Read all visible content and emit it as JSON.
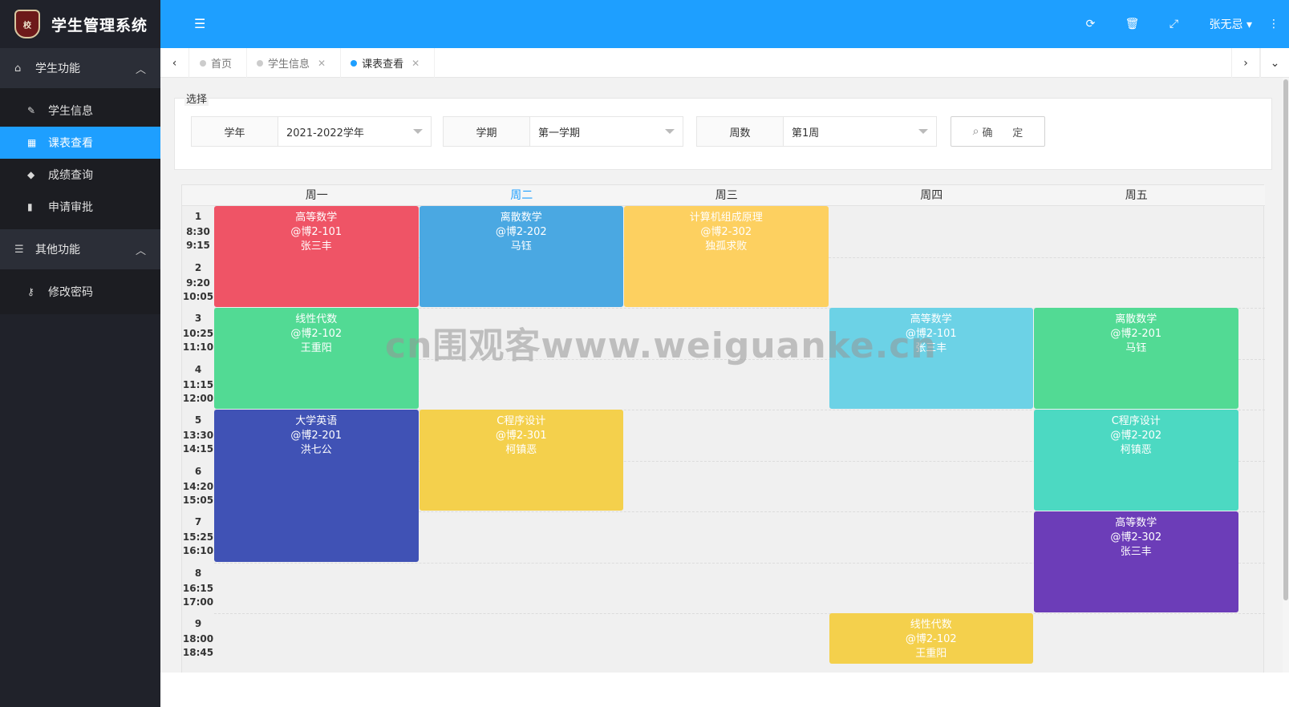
{
  "app": {
    "title": "学生管理系统",
    "logo_text": "校"
  },
  "sidebar": {
    "groups": [
      {
        "label": "学生功能",
        "icon": "home-icon",
        "items": [
          {
            "label": "学生信息",
            "icon": "pencil-icon"
          },
          {
            "label": "课表查看",
            "icon": "table-icon"
          },
          {
            "label": "成绩查询",
            "icon": "graduation-cap-icon"
          },
          {
            "label": "申请审批",
            "icon": "book-icon"
          }
        ]
      },
      {
        "label": "其他功能",
        "icon": "list-icon",
        "items": [
          {
            "label": "修改密码",
            "icon": "key-icon"
          }
        ]
      }
    ]
  },
  "header": {
    "user": "张无忌"
  },
  "tabs": [
    {
      "label": "首页"
    },
    {
      "label": "学生信息"
    },
    {
      "label": "课表查看"
    }
  ],
  "filter": {
    "legend": "选择",
    "year_label": "学年",
    "year_value": "2021-2022学年",
    "term_label": "学期",
    "term_value": "第一学期",
    "week_label": "周数",
    "week_value": "第1周",
    "confirm": "确      定"
  },
  "timetable": {
    "days": [
      "周一",
      "周二",
      "周三",
      "周四",
      "周五"
    ],
    "today_index": 1,
    "periods": [
      {
        "num": "1",
        "start": "8:30",
        "end": "9:15"
      },
      {
        "num": "2",
        "start": "9:20",
        "end": "10:05"
      },
      {
        "num": "3",
        "start": "10:25",
        "end": "11:10"
      },
      {
        "num": "4",
        "start": "11:15",
        "end": "12:00"
      },
      {
        "num": "5",
        "start": "13:30",
        "end": "14:15"
      },
      {
        "num": "6",
        "start": "14:20",
        "end": "15:05"
      },
      {
        "num": "7",
        "start": "15:25",
        "end": "16:10"
      },
      {
        "num": "8",
        "start": "16:15",
        "end": "17:00"
      },
      {
        "num": "9",
        "start": "18:00",
        "end": "18:45"
      }
    ],
    "courses": [
      {
        "day": 0,
        "start": 1,
        "span": 2,
        "name": "高等数学",
        "room": "@博2-101",
        "teacher": "张三丰",
        "color": "#ef5466"
      },
      {
        "day": 1,
        "start": 1,
        "span": 2,
        "name": "离散数学",
        "room": "@博2-202",
        "teacher": "马钰",
        "color": "#4aa8e2"
      },
      {
        "day": 2,
        "start": 1,
        "span": 2,
        "name": "计算机组成原理",
        "room": "@博2-302",
        "teacher": "独孤求败",
        "color": "#fdd060"
      },
      {
        "day": 0,
        "start": 3,
        "span": 2,
        "name": "线性代数",
        "room": "@博2-102",
        "teacher": "王重阳",
        "color": "#52da94"
      },
      {
        "day": 3,
        "start": 3,
        "span": 2,
        "name": "高等数学",
        "room": "@博2-101",
        "teacher": "张三丰",
        "color": "#6cd2e6"
      },
      {
        "day": 4,
        "start": 3,
        "span": 2,
        "name": "离散数学",
        "room": "@博2-201",
        "teacher": "马钰",
        "color": "#52da94"
      },
      {
        "day": 0,
        "start": 5,
        "span": 3,
        "name": "大学英语",
        "room": "@博2-201",
        "teacher": "洪七公",
        "color": "#4052b5"
      },
      {
        "day": 1,
        "start": 5,
        "span": 2,
        "name": "C程序设计",
        "room": "@博2-301",
        "teacher": "柯镇恶",
        "color": "#f4d04c"
      },
      {
        "day": 4,
        "start": 5,
        "span": 2,
        "name": "C程序设计",
        "room": "@博2-202",
        "teacher": "柯镇恶",
        "color": "#4cd9c2"
      },
      {
        "day": 4,
        "start": 7,
        "span": 2,
        "name": "高等数学",
        "room": "@博2-302",
        "teacher": "张三丰",
        "color": "#6c3db8"
      },
      {
        "day": 3,
        "start": 9,
        "span": 1,
        "name": "线性代数",
        "room": "@博2-102",
        "teacher": "王重阳",
        "color": "#f4d04c"
      }
    ]
  },
  "watermark": "cn围观客www.weiguanke.cn"
}
